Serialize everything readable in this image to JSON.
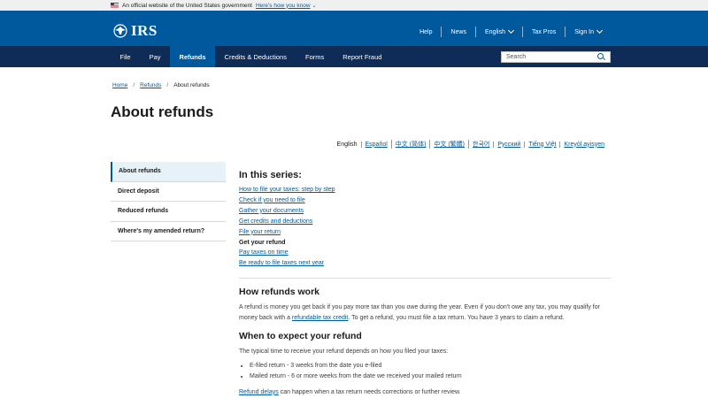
{
  "gov_banner": {
    "text": "An official website of the United States government",
    "link": "Here's how you know"
  },
  "header": {
    "logo": "IRS",
    "utility_nav": [
      {
        "label": "Help"
      },
      {
        "label": "News"
      },
      {
        "label": "English"
      },
      {
        "label": "Tax Pros"
      },
      {
        "label": "Sign In"
      }
    ]
  },
  "main_nav": {
    "items": [
      "File",
      "Pay",
      "Refunds",
      "Credits & Deductions",
      "Forms",
      "Report Fraud"
    ],
    "active": "Refunds",
    "search_placeholder": "Search"
  },
  "breadcrumb": [
    "Home",
    "Refunds",
    "About refunds"
  ],
  "page_title": "About refunds",
  "languages": [
    "English",
    "Español",
    "中文 (简体)",
    "中文 (繁體)",
    "한국어",
    "Русский",
    "Tiếng Việt",
    "Kreyòl ayisyen"
  ],
  "sidebar": {
    "items": [
      "About refunds",
      "Direct deposit",
      "Reduced refunds",
      "Where's my amended return?"
    ],
    "active": "About refunds"
  },
  "series": {
    "heading": "In this series:",
    "items": [
      "How to file your taxes: step by step",
      "Check if you need to file",
      "Gather your documents",
      "Get credits and deductions",
      "File your return",
      "Get your refund",
      "Pay taxes on time",
      "Be ready to file taxes next year"
    ],
    "current": "Get your refund"
  },
  "how_refunds_work": {
    "heading": "How refunds work",
    "text_1": "A refund is money you get back if you pay more tax than you owe during the year. Even if you don't owe any tax, you may qualify for money back with a ",
    "link": "refundable tax credit",
    "text_2": ". To get a refund, you must file a tax return. You have 3 years to claim a refund."
  },
  "when_to_expect": {
    "heading": "When to expect your refund",
    "intro": "The typical time to receive your refund depends on how you filed your taxes:",
    "bullets": [
      "E-filed return - 3 weeks from the date you e-filed",
      "Mailed return - 6 or more weeks from the date we received your mailed return"
    ],
    "delays_link": "Refund delays",
    "delays_text": " can happen when a tax return needs corrections or further review."
  },
  "colors": {
    "header_blue": "#00599c",
    "nav_navy": "#0e2c56",
    "link_blue": "#00599c",
    "sidebar_active_bg": "#e7f2f8"
  }
}
